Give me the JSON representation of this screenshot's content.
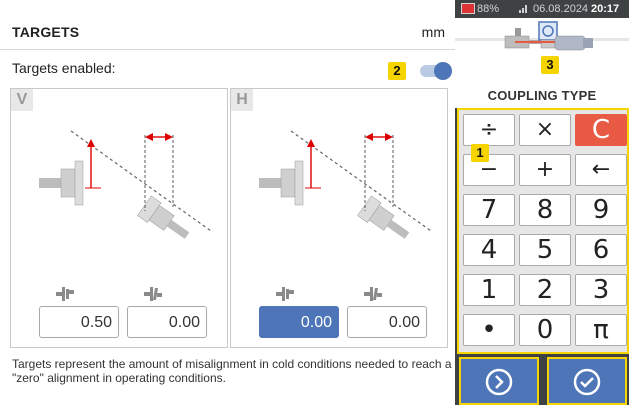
{
  "header": {
    "title": "TARGETS",
    "unit": "mm"
  },
  "targets_enabled": {
    "label": "Targets enabled:",
    "on": true,
    "badge": "2"
  },
  "cards": [
    {
      "corner": "V",
      "values": [
        "0.50",
        "0.00"
      ],
      "active_index": -1
    },
    {
      "corner": "H",
      "values": [
        "0.00",
        "0.00"
      ],
      "active_index": 0
    }
  ],
  "description": "Targets represent the amount of misalignment in cold conditions needed to reach a \"zero\" alignment in operating conditions.",
  "status_bar": {
    "battery": "88%",
    "date": "06.08.2024",
    "time": "20:17"
  },
  "coupling": {
    "label": "COUPLING TYPE",
    "badge": "3"
  },
  "keypad": {
    "badge": "1",
    "keys": [
      "÷",
      "×",
      "C",
      "−",
      "+",
      "←",
      "7",
      "8",
      "9",
      "4",
      "5",
      "6",
      "1",
      "2",
      "3",
      "•",
      "0",
      "π"
    ]
  },
  "colors": {
    "accent": "#4d75b8",
    "highlight": "#f5d400",
    "clear": "#e85a44",
    "panel": "#3f4242"
  },
  "icons": {
    "next": "chevron-right-circle-icon",
    "confirm": "check-circle-icon"
  }
}
